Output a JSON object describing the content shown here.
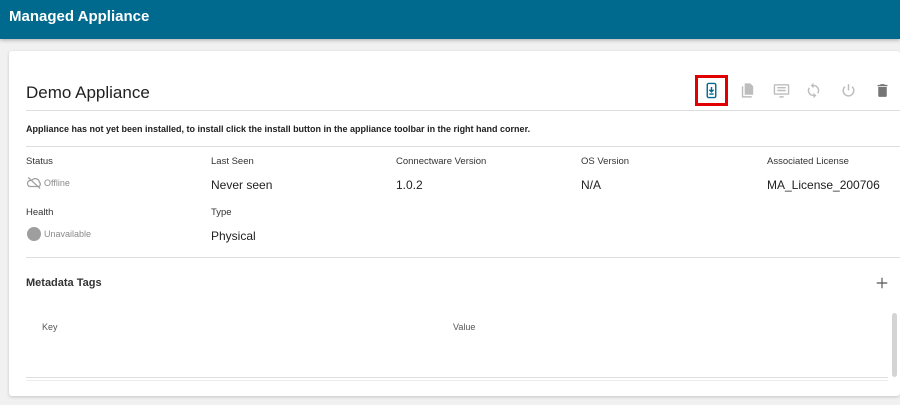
{
  "appbar": {
    "title": "Managed Appliance"
  },
  "card": {
    "title": "Demo Appliance",
    "notice": "Appliance has not yet been installed, to install click the install button in the appliance toolbar in the right hand corner."
  },
  "toolbar": {
    "install": "install-icon",
    "copy": "copy-icon",
    "console": "console-icon",
    "sync": "sync-icon",
    "power": "power-icon",
    "delete": "delete-icon",
    "highlight_color": "#e00000",
    "active_color": "#006a8e",
    "disabled_color": "#bdbdbd"
  },
  "details": {
    "status": {
      "label": "Status",
      "value": "Offline"
    },
    "last_seen": {
      "label": "Last Seen",
      "value": "Never seen"
    },
    "connectware_version": {
      "label": "Connectware Version",
      "value": "1.0.2"
    },
    "os_version": {
      "label": "OS Version",
      "value": "N/A"
    },
    "associated_license": {
      "label": "Associated License",
      "value": "MA_License_200706"
    },
    "health": {
      "label": "Health",
      "value": "Unavailable"
    },
    "type": {
      "label": "Type",
      "value": "Physical"
    }
  },
  "metadata": {
    "title": "Metadata Tags",
    "add_icon": "plus-icon",
    "columns": [
      "Key",
      "Value"
    ]
  }
}
